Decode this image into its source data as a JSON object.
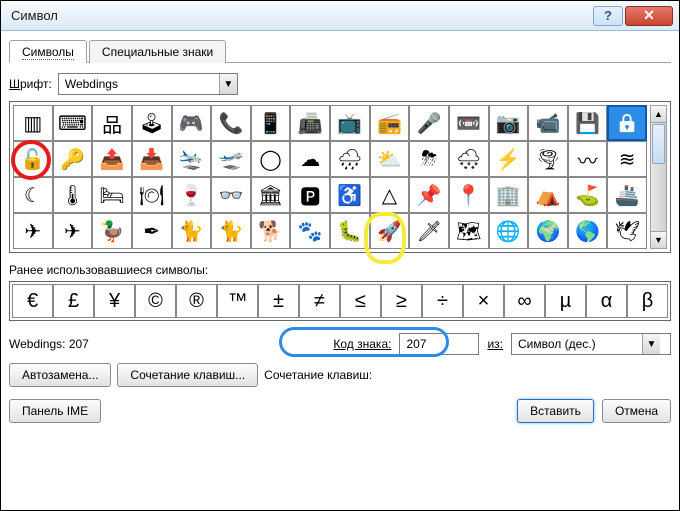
{
  "window": {
    "title": "Символ"
  },
  "tabs": {
    "symbols": "Символы",
    "special": "Специальные знаки"
  },
  "font": {
    "label_pre": "Ш",
    "label_post": "рифт:",
    "value": "Webdings"
  },
  "grid": {
    "rows": [
      [
        "▥",
        "⌨",
        "品",
        "🕹",
        "🎮",
        "📞",
        "📱",
        "📠",
        "📺",
        "📻",
        "🎤",
        "📼",
        "📷",
        "📹",
        "💾",
        "🔒"
      ],
      [
        "🔓",
        "🔑",
        "📤",
        "📥",
        "🛬",
        "🛫",
        "◯",
        "☁",
        "🌧",
        "⛅",
        "⛈",
        "🌨",
        "⚡",
        "🌪",
        "〰",
        "≋"
      ],
      [
        "☾",
        "🌡",
        "🛏",
        "🍽",
        "🍷",
        "👓",
        "🏛",
        "🅿",
        "♿",
        "△",
        "📌",
        "📍",
        "🏢",
        "⛺",
        "⛳",
        "🚢"
      ],
      [
        "✈",
        "✈",
        "🦆",
        "✒",
        "🐈",
        "🐈",
        "🐕",
        "🐾",
        "🐛",
        "🚀",
        "🗡",
        "🗺",
        "🌐",
        "🌍",
        "🌎",
        "🕊"
      ]
    ],
    "selected": {
      "row": 0,
      "col": 15
    }
  },
  "recent_label": "Ранее использовавшиеся символы:",
  "recent": [
    "€",
    "£",
    "¥",
    "©",
    "®",
    "™",
    "±",
    "≠",
    "≤",
    "≥",
    "÷",
    "×",
    "∞",
    "µ",
    "α",
    "β"
  ],
  "info": {
    "font_code_label": "Webdings: 207",
    "code_label": "Код знака:",
    "code_value": "207",
    "from_label": "из:",
    "from_value": "Символ (дес.)"
  },
  "buttons": {
    "autocorrect": "Автозамена...",
    "shortcut": "Сочетание клавиш...",
    "shortcut_label": "Сочетание клавиш:",
    "ime": "Панель IME",
    "insert": "Вставить",
    "cancel": "Отмена"
  }
}
